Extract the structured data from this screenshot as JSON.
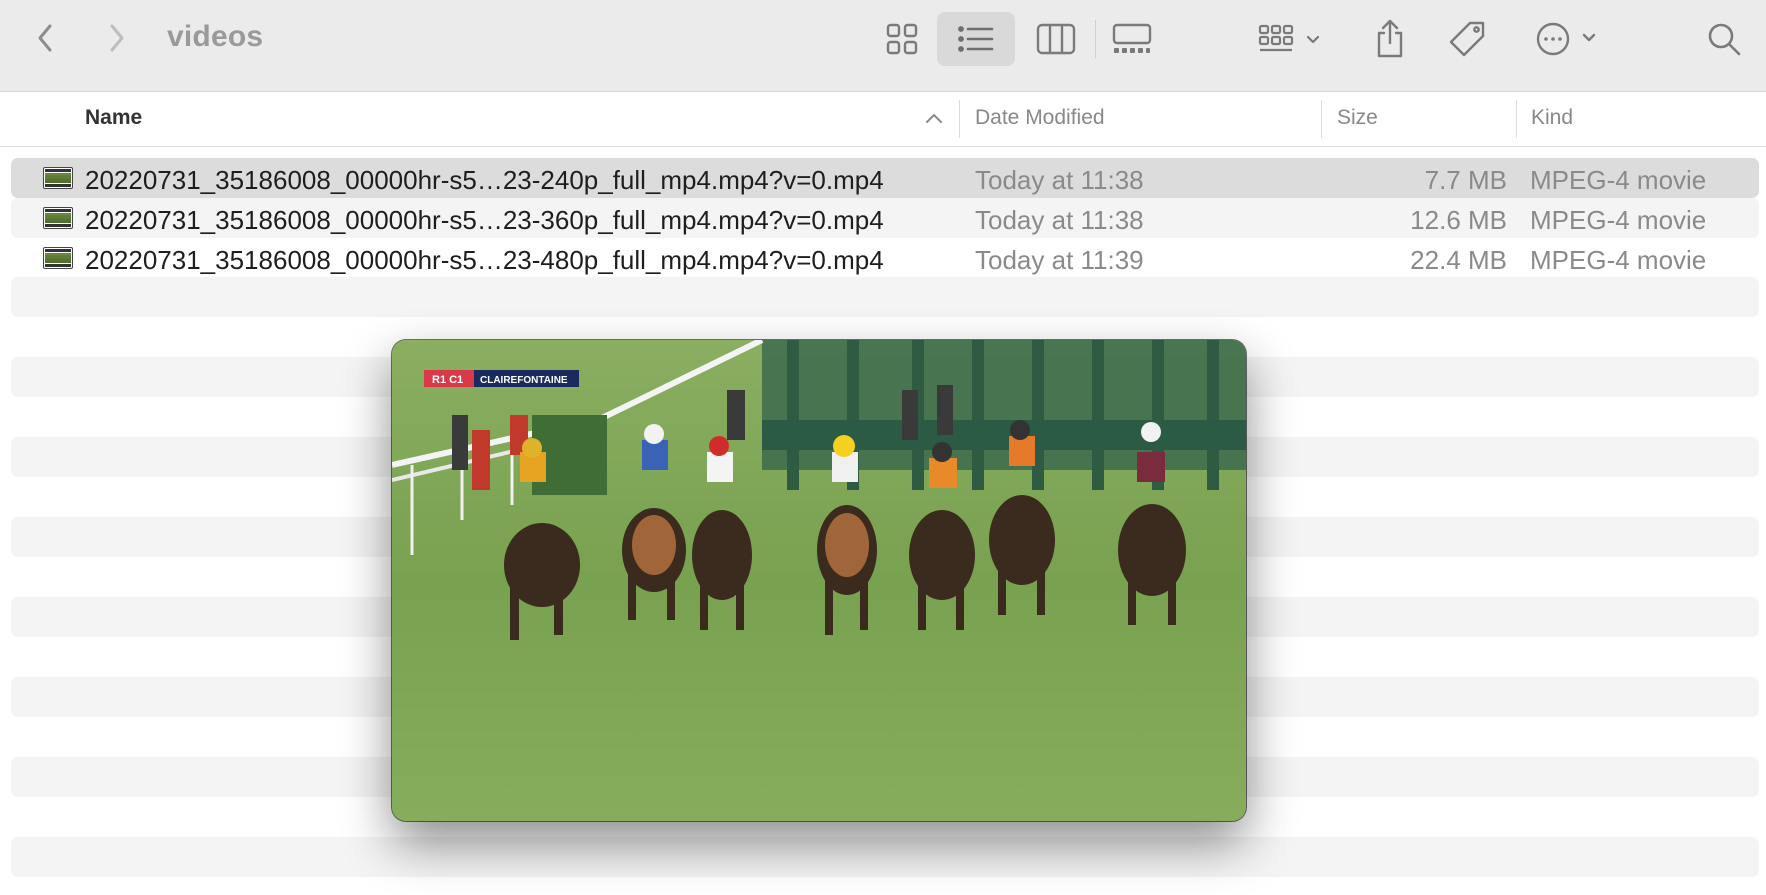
{
  "window": {
    "title": "videos"
  },
  "toolbar": {
    "back_icon": "chevron-left-icon",
    "forward_icon": "chevron-right-icon",
    "views": [
      "icon-view",
      "list-view",
      "column-view",
      "gallery-view"
    ],
    "selected_view": "list-view",
    "group_icon": "group-by-icon",
    "share_icon": "share-icon",
    "tag_icon": "tag-icon",
    "more_icon": "ellipsis-circle-icon",
    "search_icon": "search-icon"
  },
  "columns": {
    "name": "Name",
    "date": "Date Modified",
    "size": "Size",
    "kind": "Kind"
  },
  "files": [
    {
      "name": "20220731_35186008_00000hr-s5…23-240p_full_mp4.mp4?v=0.mp4",
      "date": "Today at 11:38",
      "size": "7.7 MB",
      "kind": "MPEG-4 movie"
    },
    {
      "name": "20220731_35186008_00000hr-s5…23-360p_full_mp4.mp4?v=0.mp4",
      "date": "Today at 11:38",
      "size": "12.6 MB",
      "kind": "MPEG-4 movie"
    },
    {
      "name": "20220731_35186008_00000hr-s5…23-480p_full_mp4.mp4?v=0.mp4",
      "date": "Today at 11:39",
      "size": "22.4 MB",
      "kind": "MPEG-4 movie"
    }
  ],
  "preview": {
    "score_label": "R1 C1",
    "broadcast_label": "CLAIREFONTAINE"
  },
  "colors": {
    "toolbar_bg": "#ebebeb",
    "selected_row": "#dcdcdc",
    "alt_row": "#f4f4f4",
    "grass": "#7fa55a"
  }
}
